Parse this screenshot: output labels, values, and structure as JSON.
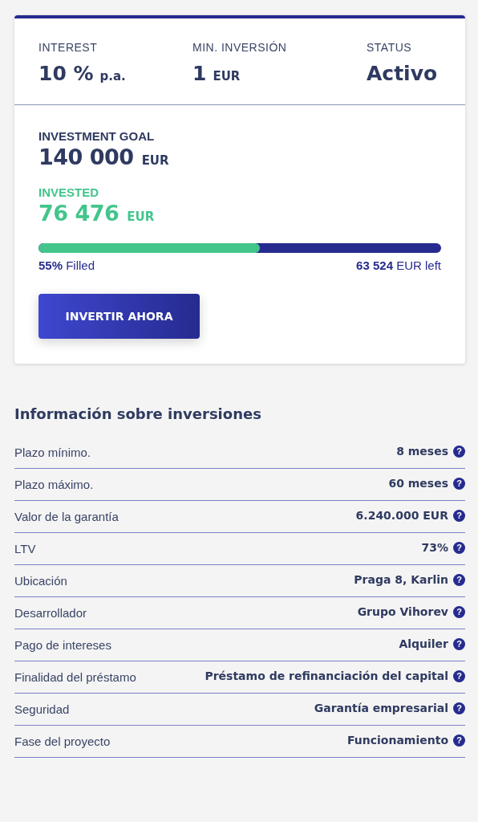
{
  "summary": [
    {
      "label": "INTEREST",
      "value": "10 %",
      "unit": "p.a."
    },
    {
      "label": "MIN. INVERSIÓN",
      "value": "1",
      "unit": "EUR"
    },
    {
      "label": "STATUS",
      "value": "Activo"
    }
  ],
  "goal": {
    "label": "INVESTMENT GOAL",
    "value": "140 000",
    "unit": "EUR"
  },
  "invested": {
    "label": "INVESTED",
    "value": "76 476",
    "unit": "EUR"
  },
  "progress": {
    "level": 0.55,
    "filled": "**55%** Filled",
    "left": "**63 524** EUR left"
  },
  "invest_button": "INVERTIR AHORA",
  "info": {
    "title": "Información sobre inversiones",
    "rows": [
      {
        "label": "Plazo mínimo.",
        "value": "8 meses",
        "help": "?"
      },
      {
        "label": "Plazo máximo.",
        "value": "60 meses",
        "help": "?"
      },
      {
        "label": "Valor de la garantía",
        "value": "6.240.000 EUR",
        "help": "?"
      },
      {
        "label": "LTV",
        "value": "73%",
        "help": "?"
      },
      {
        "label": "Ubicación",
        "value": "Praga 8, Karlin",
        "help": "?"
      },
      {
        "label": "Desarrollador",
        "value": "Grupo Vihorev",
        "help": "?"
      },
      {
        "label": "Pago de intereses",
        "value": "Alquiler",
        "help": "?"
      },
      {
        "label": "Finalidad del préstamo",
        "value": "Préstamo de refinanciación del capital",
        "help": "?"
      },
      {
        "label": "Seguridad",
        "value": "Garantía empresarial",
        "help": "?"
      },
      {
        "label": "Fase del proyecto",
        "value": "Funcionamiento",
        "help": "?"
      }
    ]
  }
}
